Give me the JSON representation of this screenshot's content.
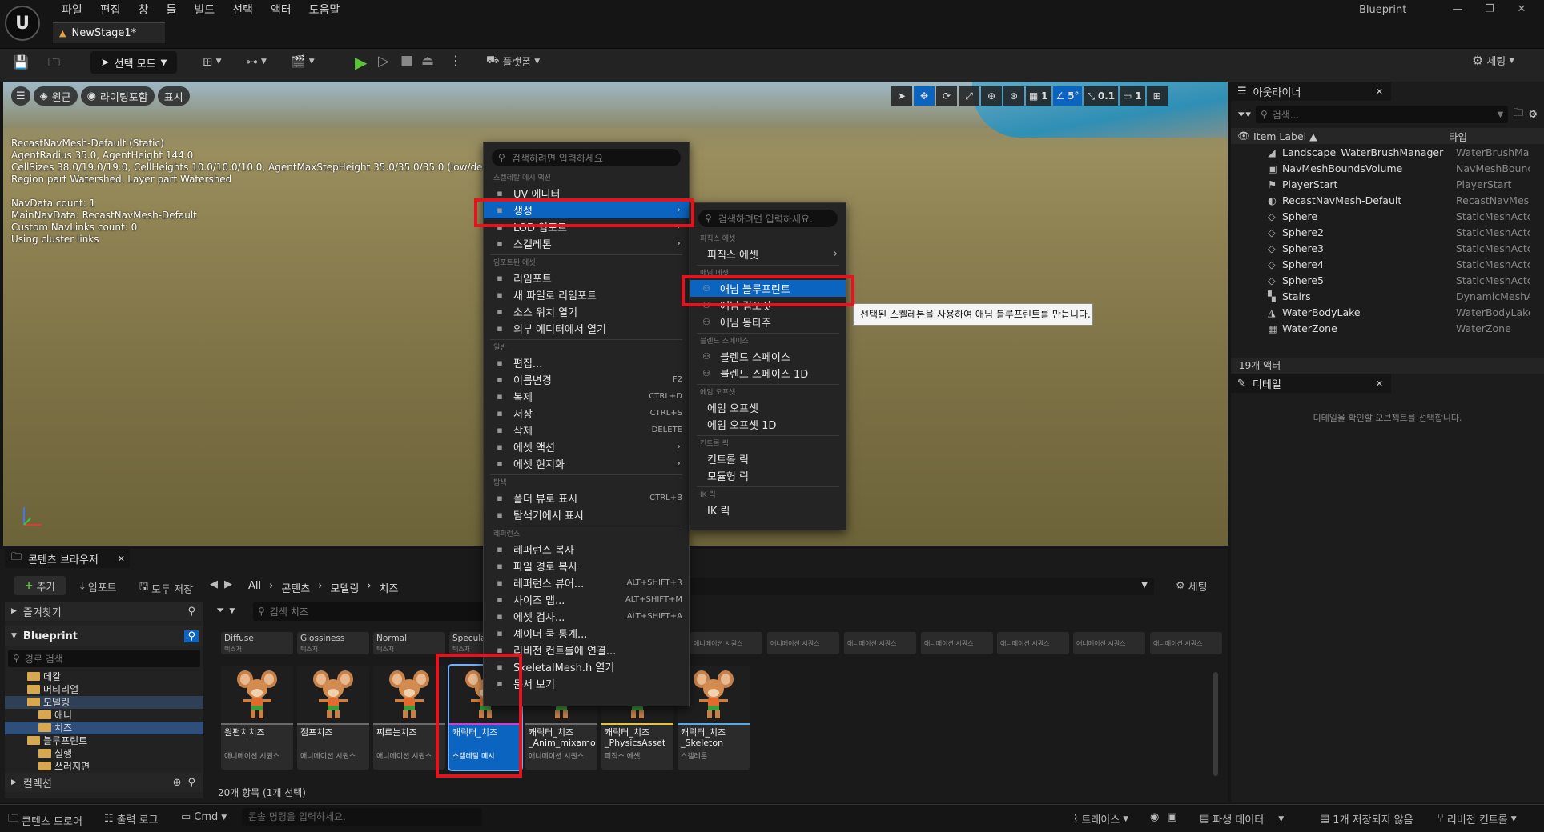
{
  "menubar": [
    "파일",
    "편집",
    "창",
    "툴",
    "빌드",
    "선택",
    "액터",
    "도움말"
  ],
  "document_tab": "NewStage1*",
  "window_title": "Blueprint",
  "toolbar": {
    "mode": "선택 모드",
    "platforms": "플랫폼",
    "settings": "세팅"
  },
  "viewport": {
    "view_mode": "원근",
    "lighting": "라이팅포함",
    "show": "표시",
    "stats": [
      "RecastNavMesh-Default (Static)",
      "AgentRadius 35.0, AgentHeight 144.0",
      "CellSizes 38.0/19.0/19.0, CellHeights 10.0/10.0/10.0, AgentMaxStepHeight 35.0/35.0/35.0 (low/default/h",
      "Region part Watershed, Layer part Watershed",
      "",
      "NavData count: 1",
      "MainNavData: RecastNavMesh-Default",
      "Custom NavLinks count: 0",
      "Using cluster links"
    ],
    "grid_value": "1",
    "angle_value": "5°",
    "scale_value": "0.1",
    "camera_value": "1"
  },
  "outliner": {
    "title": "아웃라이너",
    "search_placeholder": "검색...",
    "col_label": "Item Label ▲",
    "col_type": "타입",
    "rows": [
      {
        "label": "Landscape_WaterBrushManager",
        "type": "WaterBrushMar"
      },
      {
        "label": "NavMeshBoundsVolume",
        "type": "NavMeshBounc"
      },
      {
        "label": "PlayerStart",
        "type": "PlayerStart"
      },
      {
        "label": "RecastNavMesh-Default",
        "type": "RecastNavMes"
      },
      {
        "label": "Sphere",
        "type": "StaticMeshActc"
      },
      {
        "label": "Sphere2",
        "type": "StaticMeshActc"
      },
      {
        "label": "Sphere3",
        "type": "StaticMeshActc"
      },
      {
        "label": "Sphere4",
        "type": "StaticMeshActc"
      },
      {
        "label": "Sphere5",
        "type": "StaticMeshActc"
      },
      {
        "label": "Stairs",
        "type": "DynamicMeshA"
      },
      {
        "label": "WaterBodyLake",
        "type": "WaterBodyLake"
      },
      {
        "label": "WaterZone",
        "type": "WaterZone"
      }
    ],
    "count": "19개 액터"
  },
  "details": {
    "title": "디테일",
    "empty_msg": "디테일을 확인할 오브젝트를 선택합니다."
  },
  "content_browser": {
    "tab": "콘텐츠 브라우저",
    "add": "추가",
    "import": "임포트",
    "save_all": "모두 저장",
    "path": [
      "All",
      "콘텐츠",
      "모델링",
      "치즈"
    ],
    "settings": "세팅",
    "favorites": "즐겨찾기",
    "project": "Blueprint",
    "path_search_placeholder": "경로 검색",
    "asset_search_placeholder": "검색 치즈",
    "tree": [
      {
        "label": "데칼",
        "indent": 1
      },
      {
        "label": "머티리얼",
        "indent": 1
      },
      {
        "label": "모델링",
        "indent": 1
      },
      {
        "label": "애니",
        "indent": 2
      },
      {
        "label": "치즈",
        "indent": 2
      },
      {
        "label": "블루프린트",
        "indent": 1
      },
      {
        "label": "실행",
        "indent": 2
      },
      {
        "label": "쓰러지면",
        "indent": 2
      }
    ],
    "collections": "컬렉션",
    "top_assets": [
      {
        "name": "Diffuse",
        "type": "텍스처"
      },
      {
        "name": "Glossiness",
        "type": "텍스처"
      },
      {
        "name": "Normal",
        "type": "텍스처"
      },
      {
        "name": "Specular",
        "type": "텍스처"
      }
    ],
    "right_anim_label": "애니메이션 시퀀스",
    "assets": [
      {
        "name": "원펀치치즈",
        "type": "애니메이션 시퀀스"
      },
      {
        "name": "점프치즈",
        "type": "애니메이션 시퀀스"
      },
      {
        "name": "찌르는치즈",
        "type": "애니메이션 시퀀스"
      },
      {
        "name": "캐릭터_치즈",
        "type": "스켈레탈 메시"
      },
      {
        "name": "캐릭터_치즈_Anim_mixamo",
        "type": "애니메이션 시퀀스"
      },
      {
        "name": "캐릭터_치즈_PhysicsAsset",
        "type": "피직스 에셋"
      },
      {
        "name": "캐릭터_치즈_Skeleton",
        "type": "스켈레톤"
      }
    ],
    "status": "20개 항목 (1개 선택)"
  },
  "bottom_bar": {
    "drawer": "콘텐츠 드로어",
    "output_log": "출력 로그",
    "cmd": "Cmd",
    "console_placeholder": "콘솔 명령을 입력하세요.",
    "trace": "트레이스",
    "derived_data": "파생 데이터",
    "unsaved": "1개 저장되지 않음",
    "revision": "리비전 컨트롤"
  },
  "context_menu": {
    "search_placeholder": "검색하려면 입력하세요",
    "sections": [
      {
        "header": "스켈레탈 메시 액션",
        "items": [
          {
            "label": "UV 에디터",
            "icon": "uv-icon"
          },
          {
            "label": "생성",
            "icon": "create-icon",
            "arrow": true,
            "highlight": true
          },
          {
            "label": "LOD 임포트",
            "icon": "lod-icon",
            "arrow": true
          },
          {
            "label": "스켈레톤",
            "icon": "skeleton-icon",
            "arrow": true
          }
        ]
      },
      {
        "header": "임포트된 에셋",
        "items": [
          {
            "label": "리임포트",
            "icon": "reimport-icon"
          },
          {
            "label": "새 파일로 리임포트",
            "icon": "reimport-new-icon"
          },
          {
            "label": "소스 위치 열기",
            "icon": "folder-open-icon"
          },
          {
            "label": "외부 에디터에서 열기",
            "icon": "external-icon"
          }
        ]
      },
      {
        "header": "일반",
        "items": [
          {
            "label": "편집...",
            "icon": "edit-icon"
          },
          {
            "label": "이름변경",
            "icon": "rename-icon",
            "shortcut": "F2"
          },
          {
            "label": "복제",
            "icon": "duplicate-icon",
            "shortcut": "CTRL+D"
          },
          {
            "label": "저장",
            "icon": "save-icon",
            "shortcut": "CTRL+S"
          },
          {
            "label": "삭제",
            "icon": "delete-icon",
            "shortcut": "DELETE"
          },
          {
            "label": "에셋 액션",
            "icon": "wrench-icon",
            "arrow": true
          },
          {
            "label": "에셋 현지화",
            "icon": "flag-icon",
            "arrow": true
          }
        ]
      },
      {
        "header": "탐색",
        "items": [
          {
            "label": "폴더 뷰로 표시",
            "icon": "folder-view-icon",
            "shortcut": "CTRL+B"
          },
          {
            "label": "탐색기에서 표시",
            "icon": "explorer-icon"
          }
        ]
      },
      {
        "header": "레퍼런스",
        "items": [
          {
            "label": "레퍼런스 복사",
            "icon": "copy-ref-icon"
          },
          {
            "label": "파일 경로 복사",
            "icon": "copy-path-icon"
          },
          {
            "label": "레퍼런스 뷰어...",
            "icon": "ref-viewer-icon",
            "shortcut": "ALT+SHIFT+R"
          },
          {
            "label": "사이즈 맵...",
            "icon": "size-map-icon",
            "shortcut": "ALT+SHIFT+M"
          },
          {
            "label": "에셋 검사...",
            "icon": "audit-icon",
            "shortcut": "ALT+SHIFT+A"
          },
          {
            "label": "셰이더 쿡 통계...",
            "icon": "shader-icon"
          },
          {
            "label": "리비전 컨트롤에 연결...",
            "icon": "revision-icon"
          },
          {
            "label": "SkeletalMesh.h 열기",
            "icon": "code-icon"
          },
          {
            "label": "문서 보기",
            "icon": "docs-icon"
          }
        ]
      }
    ]
  },
  "submenu": {
    "search_placeholder": "검색하려면 입력하세요.",
    "sections": [
      {
        "header": "피직스 에셋",
        "items": [
          {
            "label": "피직스 에셋",
            "arrow": true
          }
        ]
      },
      {
        "header": "애님 에셋",
        "items": [
          {
            "label": "애님 블루프린트",
            "highlight": true
          },
          {
            "label": "애님 컴포짓"
          },
          {
            "label": "애님 몽타주"
          }
        ]
      },
      {
        "header": "블렌드 스페이스",
        "items": [
          {
            "label": "블렌드 스페이스"
          },
          {
            "label": "블렌드 스페이스 1D"
          }
        ]
      },
      {
        "header": "에임 오프셋",
        "items": [
          {
            "label": "에임 오프셋"
          },
          {
            "label": "에임 오프셋 1D"
          }
        ]
      },
      {
        "header": "컨트롤 릭",
        "items": [
          {
            "label": "컨트롤 릭"
          },
          {
            "label": "모듈형 릭"
          }
        ]
      },
      {
        "header": "IK 릭",
        "items": [
          {
            "label": "IK 릭"
          }
        ]
      }
    ]
  },
  "tooltip": "선택된 스켈레톤을 사용하여 애님 블루프린트를 만듭니다.",
  "colors": {
    "highlight": "#0b64c0",
    "annotation": "#e3141e",
    "folder": "#d8a74f"
  }
}
